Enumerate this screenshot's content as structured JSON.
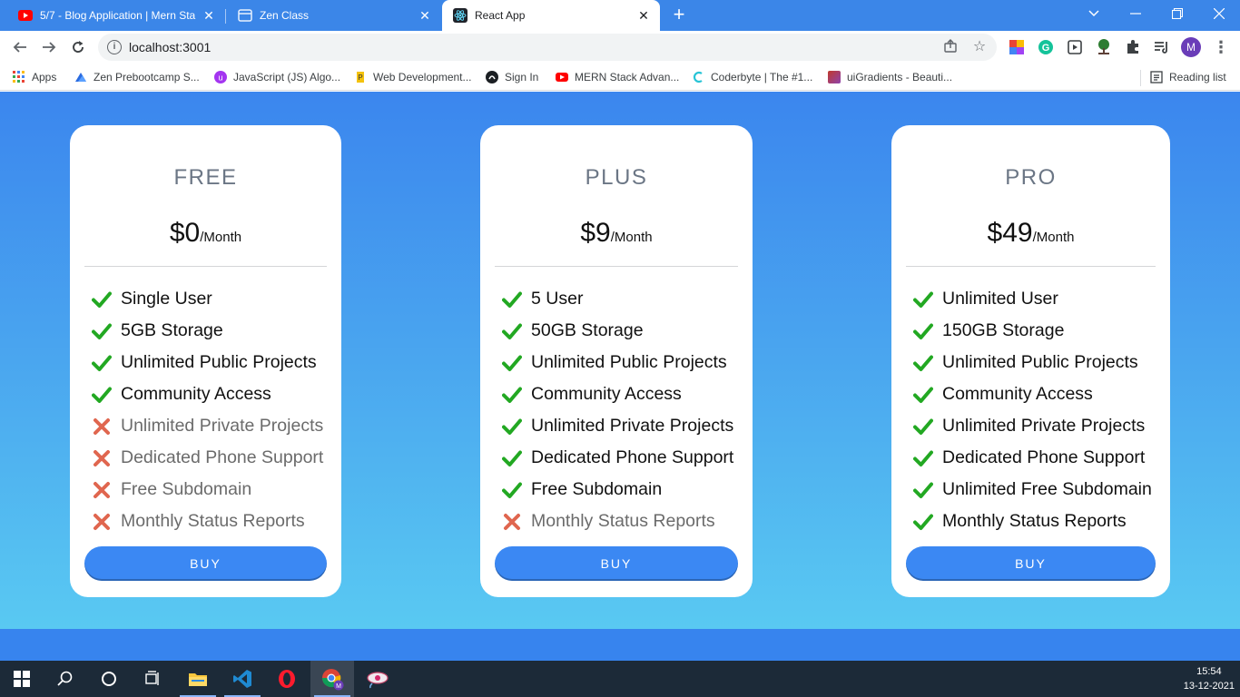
{
  "browser": {
    "tabs": [
      {
        "title": "5/7 - Blog Application | Mern Sta",
        "favicon": "youtube-icon"
      },
      {
        "title": "Zen Class",
        "favicon": "page-icon"
      },
      {
        "title": "React App",
        "favicon": "react-icon",
        "active": true
      }
    ],
    "url": "localhost:3001",
    "profile_initial": "M",
    "bookmarks": [
      {
        "label": "Apps",
        "icon": "apps-grid-icon"
      },
      {
        "label": "Zen Prebootcamp S...",
        "icon": "zen-icon"
      },
      {
        "label": "JavaScript (JS) Algo...",
        "icon": "udemy-icon"
      },
      {
        "label": "Web Development...",
        "icon": "bookmark-icon"
      },
      {
        "label": "Sign In",
        "icon": "github-icon"
      },
      {
        "label": "MERN Stack Advan...",
        "icon": "youtube-icon"
      },
      {
        "label": "Coderbyte | The #1...",
        "icon": "coderbyte-icon"
      },
      {
        "label": "uiGradients - Beauti...",
        "icon": "uigradients-icon"
      }
    ],
    "reading_list": "Reading list"
  },
  "plans": [
    {
      "name": "FREE",
      "price": "$0",
      "period": "/Month",
      "features": [
        {
          "text": "Single User",
          "included": true
        },
        {
          "text": "5GB Storage",
          "included": true
        },
        {
          "text": "Unlimited Public Projects",
          "included": true
        },
        {
          "text": "Community Access",
          "included": true
        },
        {
          "text": "Unlimited Private Projects",
          "included": false
        },
        {
          "text": "Dedicated Phone Support",
          "included": false
        },
        {
          "text": "Free Subdomain",
          "included": false
        },
        {
          "text": "Monthly Status Reports",
          "included": false
        }
      ],
      "button": "BUY"
    },
    {
      "name": "PLUS",
      "price": "$9",
      "period": "/Month",
      "features": [
        {
          "text": "5 User",
          "included": true
        },
        {
          "text": "50GB Storage",
          "included": true
        },
        {
          "text": "Unlimited Public Projects",
          "included": true
        },
        {
          "text": "Community Access",
          "included": true
        },
        {
          "text": "Unlimited Private Projects",
          "included": true
        },
        {
          "text": "Dedicated Phone Support",
          "included": true
        },
        {
          "text": "Free Subdomain",
          "included": true
        },
        {
          "text": "Monthly Status Reports",
          "included": false
        }
      ],
      "button": "BUY"
    },
    {
      "name": "PRO",
      "price": "$49",
      "period": "/Month",
      "features": [
        {
          "text": "Unlimited User",
          "included": true
        },
        {
          "text": "150GB Storage",
          "included": true
        },
        {
          "text": "Unlimited Public Projects",
          "included": true
        },
        {
          "text": "Community Access",
          "included": true
        },
        {
          "text": "Unlimited Private Projects",
          "included": true
        },
        {
          "text": "Dedicated Phone Support",
          "included": true
        },
        {
          "text": "Unlimited Free Subdomain",
          "included": true
        },
        {
          "text": "Monthly Status Reports",
          "included": true
        }
      ],
      "button": "BUY"
    }
  ],
  "taskbar": {
    "time": "15:54",
    "date": "13-12-2021",
    "apps": [
      "windows-start-icon",
      "search-icon",
      "cortana-icon",
      "task-view-icon",
      "file-explorer-icon",
      "vscode-icon",
      "opera-icon",
      "chrome-icon",
      "app-icon"
    ]
  },
  "colors": {
    "check": "#22a822",
    "cross": "#e0664f",
    "accent": "#3b88f3"
  }
}
